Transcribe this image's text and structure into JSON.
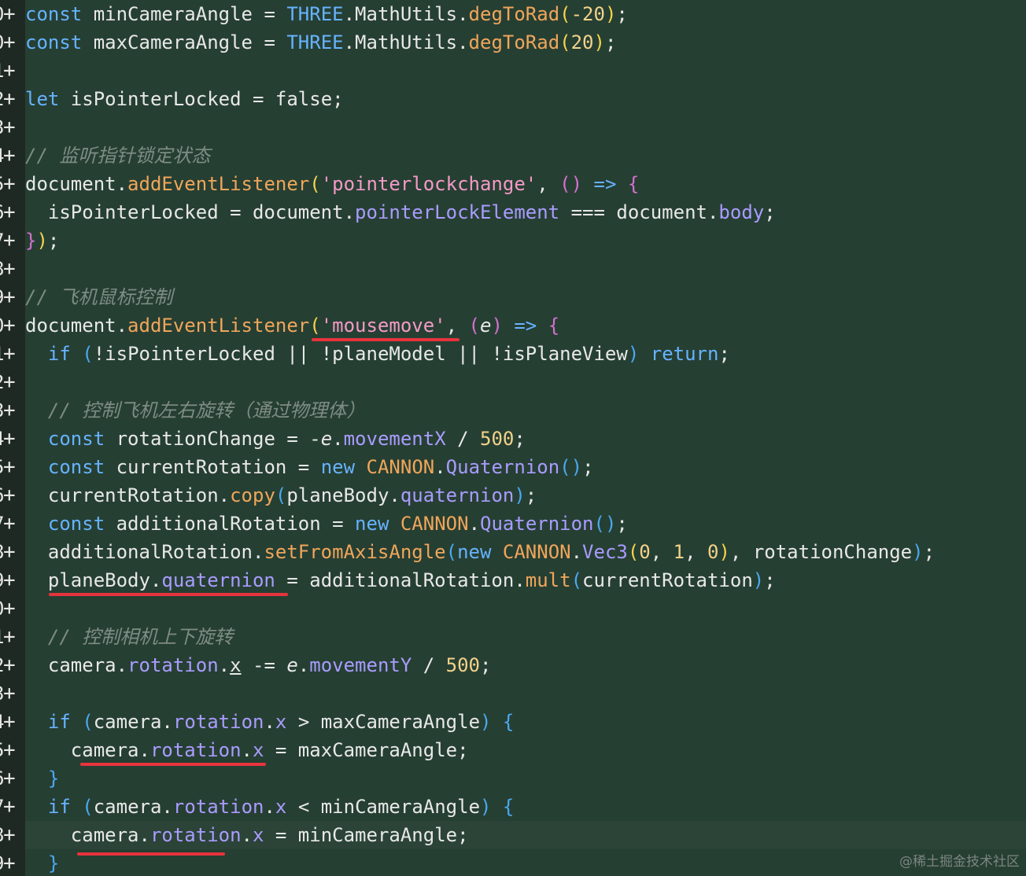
{
  "gutter": {
    "line_number_digits": [
      "0",
      "0",
      "1",
      "2",
      "3",
      "4",
      "5",
      "6",
      "7",
      "8",
      "9",
      "0",
      "1",
      "2",
      "3",
      "4",
      "5",
      "6",
      "7",
      "8",
      "9",
      "0",
      "1",
      "2",
      "3",
      "4",
      "5",
      "6",
      "7",
      "8",
      "9"
    ],
    "diff_marker": "+"
  },
  "colors": {
    "background": "#263f33",
    "gutter_background": "#1f2923",
    "keyword": "#66b3ff",
    "function": "#f0a65a",
    "property": "#a99cff",
    "string": "#f39ac6",
    "number": "#f2d28a",
    "comment": "#7e8c84",
    "annotation_underline": "#e8333d"
  },
  "code_lines": [
    [
      [
        "kw",
        "const"
      ],
      [
        "var",
        " minCameraAngle "
      ],
      [
        "op",
        "= "
      ],
      [
        "kw",
        "THREE"
      ],
      [
        "var",
        ".MathUtils."
      ],
      [
        "fn",
        "degToRad"
      ],
      [
        "b1",
        "("
      ],
      [
        "num",
        "-20"
      ],
      [
        "b1",
        ")"
      ],
      [
        "var",
        ";"
      ]
    ],
    [
      [
        "kw",
        "const"
      ],
      [
        "var",
        " maxCameraAngle "
      ],
      [
        "op",
        "= "
      ],
      [
        "kw",
        "THREE"
      ],
      [
        "var",
        ".MathUtils."
      ],
      [
        "fn",
        "degToRad"
      ],
      [
        "b1",
        "("
      ],
      [
        "num",
        "20"
      ],
      [
        "b1",
        ")"
      ],
      [
        "var",
        ";"
      ]
    ],
    [],
    [
      [
        "kw",
        "let"
      ],
      [
        "var",
        " isPointerLocked = false;"
      ]
    ],
    [],
    [
      [
        "com",
        "// 监听指针锁定状态"
      ]
    ],
    [
      [
        "var",
        "document."
      ],
      [
        "fn",
        "addEventListener"
      ],
      [
        "b1",
        "("
      ],
      [
        "str",
        "'pointerlockchange'"
      ],
      [
        "var",
        ", "
      ],
      [
        "b2",
        "()"
      ],
      [
        "kw",
        " =>"
      ],
      [
        "var",
        " "
      ],
      [
        "b2",
        "{"
      ]
    ],
    [
      [
        "var",
        "  isPointerLocked = document."
      ],
      [
        "prop",
        "pointerLockElement"
      ],
      [
        "var",
        " === document."
      ],
      [
        "prop",
        "body"
      ],
      [
        "var",
        ";"
      ]
    ],
    [
      [
        "b2",
        "}"
      ],
      [
        "b1",
        ")"
      ],
      [
        "var",
        ";"
      ]
    ],
    [],
    [
      [
        "com",
        "// 飞机鼠标控制"
      ]
    ],
    [
      [
        "var",
        "document."
      ],
      [
        "fn",
        "addEventListener"
      ],
      [
        "b1",
        "("
      ],
      [
        "str",
        "'mousemove'"
      ],
      [
        "var",
        ", "
      ],
      [
        "b2",
        "("
      ],
      [
        "ivar",
        "e"
      ],
      [
        "b2",
        ")"
      ],
      [
        "kw",
        " =>"
      ],
      [
        "var",
        " "
      ],
      [
        "b2",
        "{"
      ]
    ],
    [
      [
        "var",
        "  "
      ],
      [
        "kw",
        "if"
      ],
      [
        "var",
        " "
      ],
      [
        "b3",
        "("
      ],
      [
        "var",
        "!isPointerLocked || !planeModel || !isPlaneView"
      ],
      [
        "b3",
        ")"
      ],
      [
        "var",
        " "
      ],
      [
        "kw",
        "return"
      ],
      [
        "var",
        ";"
      ]
    ],
    [],
    [
      [
        "com",
        "  // 控制飞机左右旋转（通过物理体）"
      ]
    ],
    [
      [
        "var",
        "  "
      ],
      [
        "kw",
        "const"
      ],
      [
        "var",
        " rotationChange = -"
      ],
      [
        "ivar",
        "e"
      ],
      [
        "var",
        "."
      ],
      [
        "prop",
        "movementX"
      ],
      [
        "var",
        " / "
      ],
      [
        "num",
        "500"
      ],
      [
        "var",
        ";"
      ]
    ],
    [
      [
        "var",
        "  "
      ],
      [
        "kw",
        "const"
      ],
      [
        "var",
        " currentRotation = "
      ],
      [
        "kw",
        "new"
      ],
      [
        "var",
        " "
      ],
      [
        "cls",
        "CANNON"
      ],
      [
        "var",
        "."
      ],
      [
        "prop",
        "Quaternion"
      ],
      [
        "b3",
        "()"
      ],
      [
        "var",
        ";"
      ]
    ],
    [
      [
        "var",
        "  currentRotation."
      ],
      [
        "fn",
        "copy"
      ],
      [
        "b3",
        "("
      ],
      [
        "var",
        "planeBody."
      ],
      [
        "prop",
        "quaternion"
      ],
      [
        "b3",
        ")"
      ],
      [
        "var",
        ";"
      ]
    ],
    [
      [
        "var",
        "  "
      ],
      [
        "kw",
        "const"
      ],
      [
        "var",
        " additionalRotation = "
      ],
      [
        "kw",
        "new"
      ],
      [
        "var",
        " "
      ],
      [
        "cls",
        "CANNON"
      ],
      [
        "var",
        "."
      ],
      [
        "prop",
        "Quaternion"
      ],
      [
        "b3",
        "()"
      ],
      [
        "var",
        ";"
      ]
    ],
    [
      [
        "var",
        "  additionalRotation."
      ],
      [
        "fn",
        "setFromAxisAngle"
      ],
      [
        "b3",
        "("
      ],
      [
        "kw",
        "new"
      ],
      [
        "var",
        " "
      ],
      [
        "cls",
        "CANNON"
      ],
      [
        "var",
        "."
      ],
      [
        "prop",
        "Vec3"
      ],
      [
        "b1",
        "("
      ],
      [
        "num",
        "0"
      ],
      [
        "var",
        ", "
      ],
      [
        "num",
        "1"
      ],
      [
        "var",
        ", "
      ],
      [
        "num",
        "0"
      ],
      [
        "b1",
        ")"
      ],
      [
        "var",
        ", rotationChange"
      ],
      [
        "b3",
        ")"
      ],
      [
        "var",
        ";"
      ]
    ],
    [
      [
        "var",
        "  planeBody."
      ],
      [
        "prop",
        "quaternion"
      ],
      [
        "var",
        " = additionalRotation."
      ],
      [
        "fn",
        "mult"
      ],
      [
        "b3",
        "("
      ],
      [
        "var",
        "currentRotation"
      ],
      [
        "b3",
        ")"
      ],
      [
        "var",
        ";"
      ]
    ],
    [],
    [
      [
        "com",
        "  // 控制相机上下旋转"
      ]
    ],
    [
      [
        "var",
        "  camera."
      ],
      [
        "prop",
        "rotation"
      ],
      [
        "var",
        "."
      ],
      [
        "ul",
        "x"
      ],
      [
        "var",
        " -= "
      ],
      [
        "ivar",
        "e"
      ],
      [
        "var",
        "."
      ],
      [
        "prop",
        "movementY"
      ],
      [
        "var",
        " / "
      ],
      [
        "num",
        "500"
      ],
      [
        "var",
        ";"
      ]
    ],
    [],
    [
      [
        "var",
        "  "
      ],
      [
        "kw",
        "if"
      ],
      [
        "var",
        " "
      ],
      [
        "b3",
        "("
      ],
      [
        "var",
        "camera."
      ],
      [
        "prop",
        "rotation"
      ],
      [
        "var",
        "."
      ],
      [
        "prop",
        "x"
      ],
      [
        "var",
        " > maxCameraAngle"
      ],
      [
        "b3",
        ")"
      ],
      [
        "var",
        " "
      ],
      [
        "b3",
        "{"
      ]
    ],
    [
      [
        "var",
        "    camera."
      ],
      [
        "prop",
        "rotation"
      ],
      [
        "var",
        "."
      ],
      [
        "prop",
        "x"
      ],
      [
        "var",
        " = maxCameraAngle;"
      ]
    ],
    [
      [
        "var",
        "  "
      ],
      [
        "b3",
        "}"
      ]
    ],
    [
      [
        "var",
        "  "
      ],
      [
        "kw",
        "if"
      ],
      [
        "var",
        " "
      ],
      [
        "b3",
        "("
      ],
      [
        "var",
        "camera."
      ],
      [
        "prop",
        "rotation"
      ],
      [
        "var",
        "."
      ],
      [
        "prop",
        "x"
      ],
      [
        "var",
        " < minCameraAngle"
      ],
      [
        "b3",
        ")"
      ],
      [
        "var",
        " "
      ],
      [
        "b3",
        "{"
      ]
    ],
    [
      [
        "var",
        "    camera."
      ],
      [
        "prop",
        "rotation"
      ],
      [
        "var",
        "."
      ],
      [
        "prop",
        "x"
      ],
      [
        "var",
        " = minCameraAngle;"
      ]
    ],
    [
      [
        "var",
        "  "
      ],
      [
        "b3",
        "}"
      ]
    ]
  ],
  "current_line_index": 29,
  "watermark": "@稀土掘金技术社区"
}
